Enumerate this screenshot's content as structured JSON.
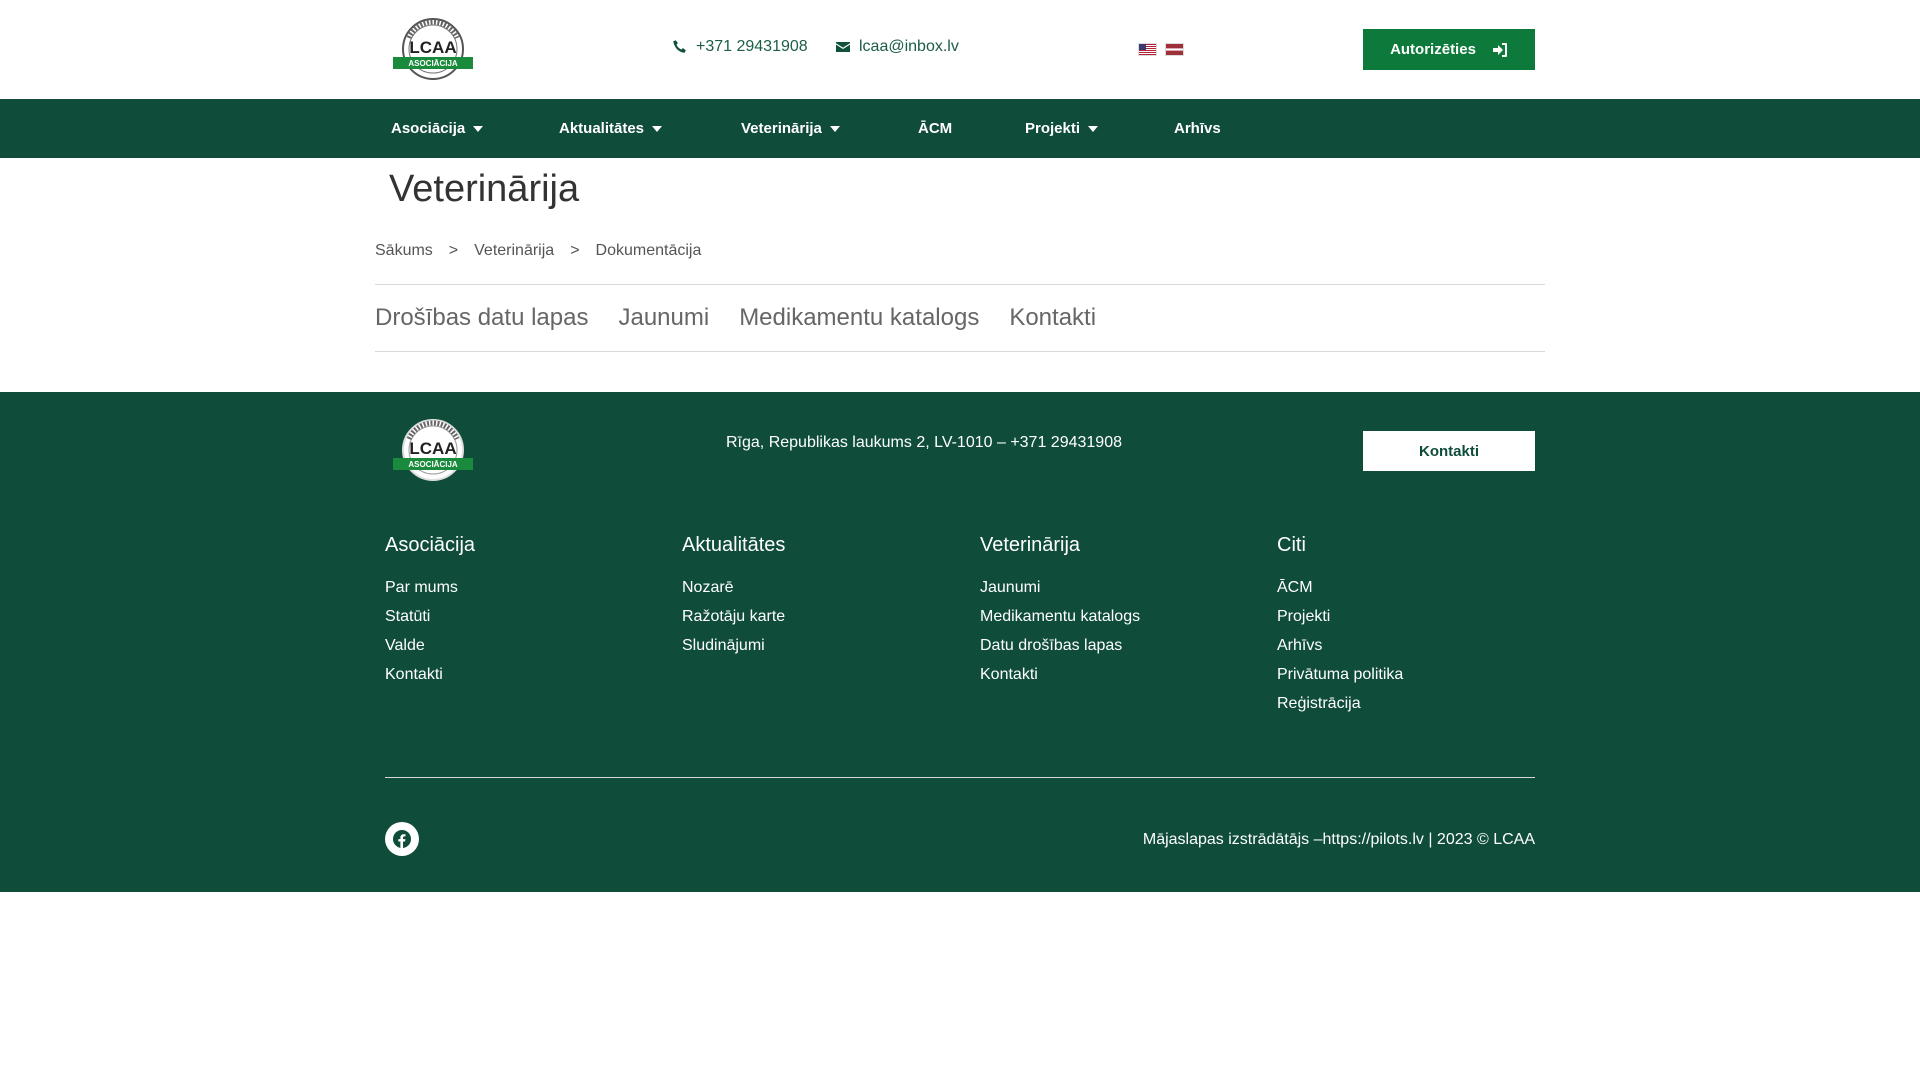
{
  "header": {
    "logo": {
      "top_text": "LATVIJAS CŪKU AUDZĒTĀJU",
      "main_text": "LCAA",
      "banner_text": "ASOCIĀCIJA",
      "green": "#1a8a3c"
    },
    "phone": "+371 29431908",
    "email": "lcaa@inbox.lv",
    "flags": [
      {
        "name": "us-flag-icon",
        "label": "English"
      },
      {
        "name": "latvia-flag-icon",
        "label": "Latviešu"
      }
    ],
    "login_label": "Autorizēties",
    "accent": "#0d7a3b"
  },
  "nav": {
    "background": "#0f4c3a",
    "items": [
      {
        "label": "Asociācija",
        "dropdown": true
      },
      {
        "label": "Aktualitātes",
        "dropdown": true
      },
      {
        "label": "Veterinārija",
        "dropdown": true
      },
      {
        "label": "ĀCM",
        "dropdown": false
      },
      {
        "label": "Projekti",
        "dropdown": true
      },
      {
        "label": "Arhīvs",
        "dropdown": false
      }
    ]
  },
  "page": {
    "title": "Veterinārija",
    "breadcrumb": [
      "Sākums",
      "Veterinārija",
      "Dokumentācija"
    ],
    "breadcrumb_sep": ">",
    "tabs": [
      "Drošības datu lapas",
      "Jaunumi",
      "Medikamentu katalogs",
      "Kontakti"
    ]
  },
  "footer": {
    "address": "Rīga, Republikas laukums 2, LV-1010 – +371 29431908",
    "contact_button": "Kontakti",
    "columns": [
      {
        "title": "Asociācija",
        "links": [
          "Par mums",
          "Statūti",
          "Valde",
          "Kontakti"
        ]
      },
      {
        "title": "Aktualitātes",
        "links": [
          "Nozarē",
          "Ražotāju karte",
          "Sludinājumi"
        ]
      },
      {
        "title": "Veterinārija",
        "links": [
          "Jaunumi",
          "Medikamentu katalogs",
          "Datu drošības lapas",
          "Kontakti"
        ]
      },
      {
        "title": "Citi",
        "links": [
          "ĀCM",
          "Projekti",
          "Arhīvs",
          "Privātuma politika",
          "Reģistrācija"
        ]
      }
    ],
    "social_icon": "facebook-icon",
    "copyright": "Mājaslapas izstrādātājs –https://pilots.lv | 2023 © LCAA"
  }
}
